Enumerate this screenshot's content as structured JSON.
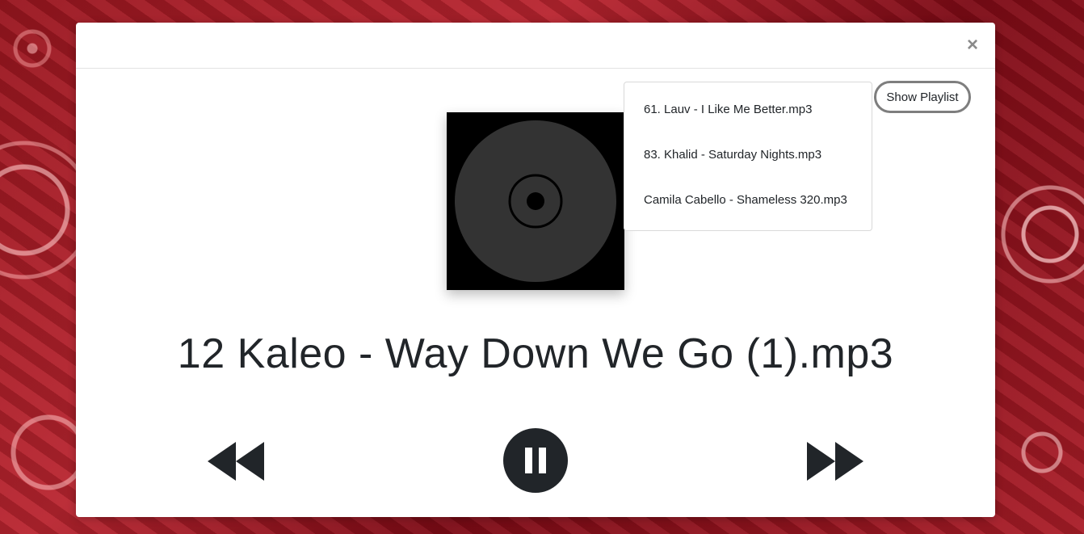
{
  "dialog": {
    "close_label": "×"
  },
  "playlist": {
    "toggle_label": "Show Playlist",
    "items": [
      {
        "label": "61. Lauv - I Like Me Better.mp3"
      },
      {
        "label": "83. Khalid - Saturday Nights.mp3"
      },
      {
        "label": "Camila Cabello - Shameless 320.mp3"
      }
    ]
  },
  "now_playing": {
    "title": "12 Kaleo - Way Down We Go (1).mp3",
    "state": "playing"
  },
  "controls": {
    "prev_icon": "rewind-icon",
    "pause_icon": "pause-icon",
    "next_icon": "fast-forward-icon"
  },
  "colors": {
    "control_dark": "#212529",
    "disc": "#333333",
    "art_background": "#000000"
  }
}
